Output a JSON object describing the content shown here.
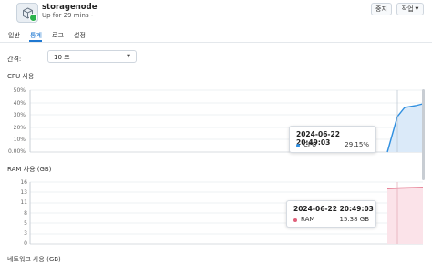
{
  "header": {
    "vm_name": "storagenode",
    "vm_status": "Up for 29 mins -",
    "stop_label": "중지",
    "action_label": "작업",
    "action_caret": "▼",
    "status_color": "#2bb24c"
  },
  "tabs": [
    {
      "label": "일반"
    },
    {
      "label": "통계"
    },
    {
      "label": "로그"
    },
    {
      "label": "설정"
    }
  ],
  "interval": {
    "label": "간격:",
    "value": "10 초",
    "caret": "▼"
  },
  "cpu_section": {
    "title": "CPU 사용",
    "y_ticks": [
      "50%",
      "40%",
      "30%",
      "20%",
      "10%",
      "0.00%"
    ],
    "tooltip": {
      "title": "2024-06-22 20:49:03",
      "series": "CPU",
      "value": "29.15%",
      "color": "#2f8fe0"
    }
  },
  "ram_section": {
    "title": "RAM 사용 (GB)",
    "y_ticks": [
      "16",
      "13",
      "11",
      "8",
      "5",
      "3",
      "0"
    ],
    "tooltip": {
      "title": "2024-06-22 20:49:03",
      "series": "RAM",
      "value": "15.38 GB",
      "color": "#e0607a"
    }
  },
  "next_section": {
    "title": "네트워크 사용 (GB)"
  }
}
